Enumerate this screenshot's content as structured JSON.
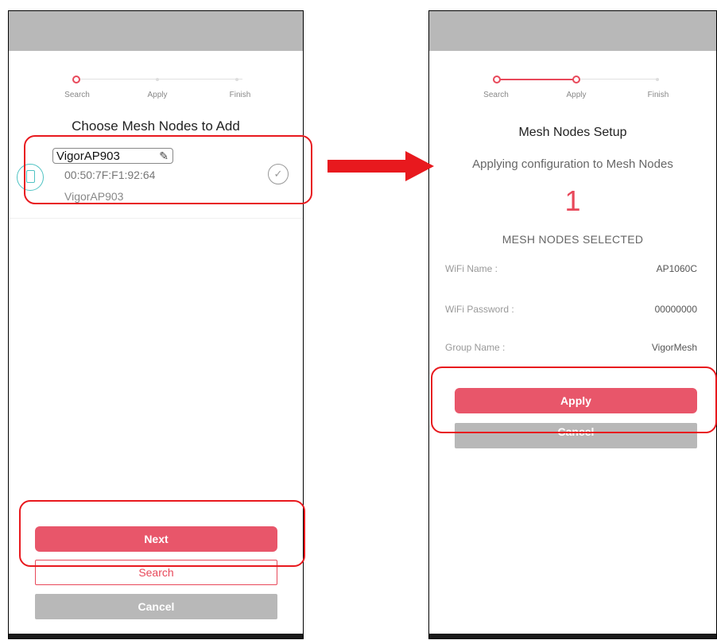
{
  "left_screen": {
    "stepper": [
      {
        "label": "Search",
        "state": "active"
      },
      {
        "label": "Apply",
        "state": "pending"
      },
      {
        "label": "Finish",
        "state": "pending"
      }
    ],
    "title": "Choose Mesh Nodes to Add",
    "device": {
      "name": "VigorAP903",
      "mac": "00:50:7F:F1:92:64",
      "model": "VigorAP903",
      "icon": "device-plug-icon",
      "edit_icon": "pencil-icon",
      "select_icon": "check-circle-icon"
    },
    "buttons": {
      "next": "Next",
      "search": "Search",
      "cancel": "Cancel"
    }
  },
  "right_screen": {
    "stepper": [
      {
        "label": "Search",
        "state": "done"
      },
      {
        "label": "Apply",
        "state": "active"
      },
      {
        "label": "Finish",
        "state": "pending"
      }
    ],
    "title": "Mesh Nodes Setup",
    "subtitle": "Applying configuration to Mesh Nodes",
    "count": "1",
    "count_caption": "MESH NODES SELECTED",
    "info": [
      {
        "label": "WiFi Name :",
        "value": "AP1060C"
      },
      {
        "label": "WiFi Password :",
        "value": "00000000"
      },
      {
        "label": "Group Name :",
        "value": "VigorMesh"
      }
    ],
    "buttons": {
      "apply": "Apply",
      "cancel": "Cancel"
    }
  },
  "colors": {
    "accent": "#e8485a",
    "highlight": "#e8191e",
    "statusbar": "#b8b8b8",
    "device_icon": "#4fc3c3"
  }
}
